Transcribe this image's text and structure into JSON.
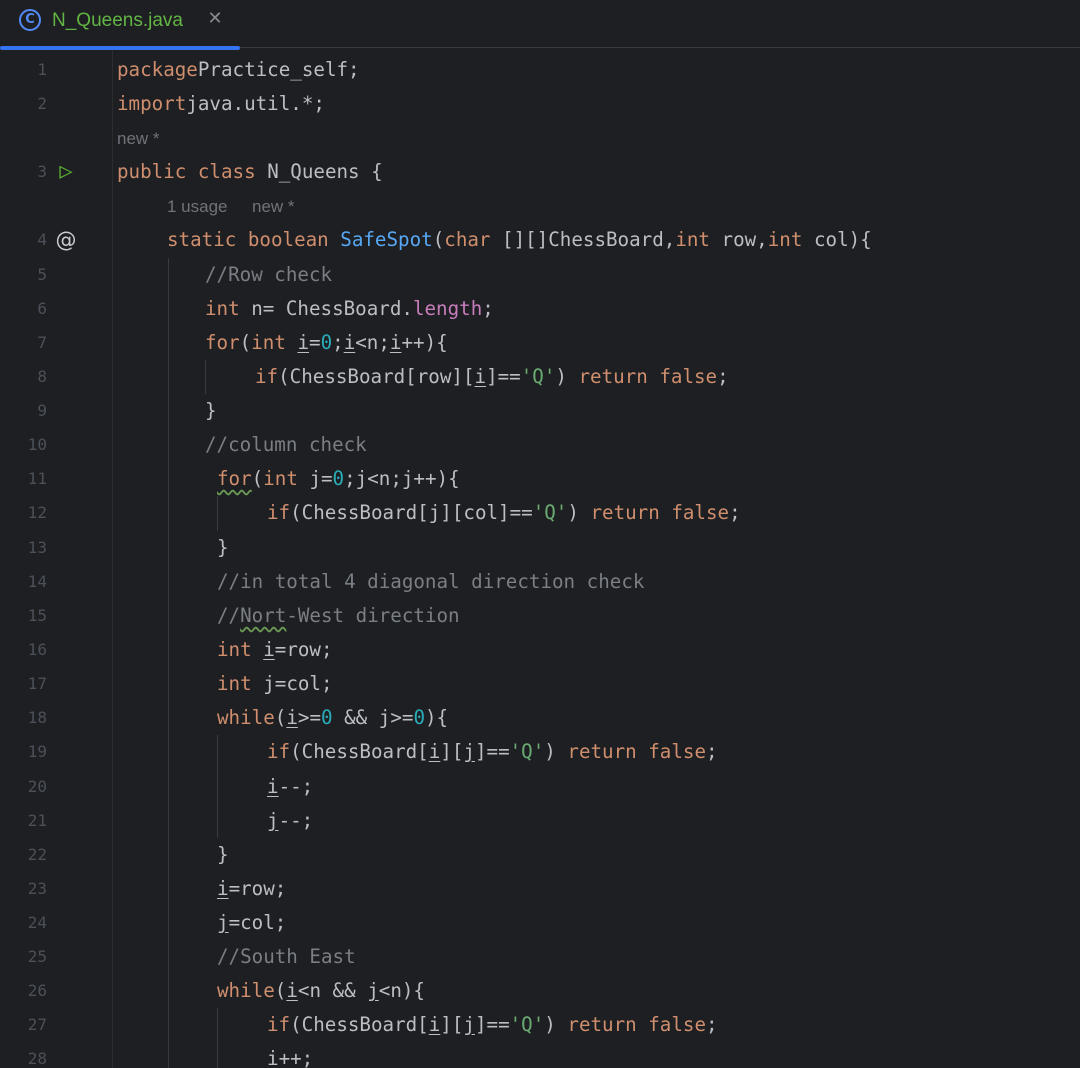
{
  "tab": {
    "icon": "class-icon",
    "icon_glyph": "C",
    "title": "N_Queens.java",
    "close_glyph": "✕"
  },
  "inlays": {
    "class_hint": "new *",
    "method_usage": "1 usage",
    "method_new": "new *"
  },
  "gutter": {
    "run_icon": "run-gutter-icon",
    "override_icon": "at-gutter-icon"
  },
  "colors": {
    "background": "#1e1f22",
    "keyword": "#cf8e6d",
    "method": "#56a8f5",
    "field": "#c77dbb",
    "number": "#2aacb8",
    "string": "#6aab73",
    "comment": "#7a7e85",
    "tab_accent": "#3574f0",
    "tab_title": "#62b543"
  },
  "lines": [
    {
      "no": "1",
      "indent": 0,
      "tokens": [
        [
          "kw",
          "package"
        ],
        [
          "",
          "Practice_self;"
        ]
      ]
    },
    {
      "no": "2",
      "indent": 0,
      "tokens": [
        [
          "kw",
          "import"
        ],
        [
          "",
          "java.util.*;"
        ]
      ]
    },
    {
      "no": "3",
      "indent": 0,
      "tokens": [
        [
          "kw",
          "public class "
        ],
        [
          "",
          "N_Queens {"
        ]
      ]
    },
    {
      "no": "4",
      "indent": 1,
      "tokens": [
        [
          "kw",
          "static boolean "
        ],
        [
          "fn",
          "SafeSpot"
        ],
        [
          "",
          "("
        ],
        [
          "kw",
          "char "
        ],
        [
          "",
          "[][]ChessBoard,"
        ],
        [
          "kw",
          "int "
        ],
        [
          "",
          "row,"
        ],
        [
          "kw",
          "int "
        ],
        [
          "",
          "col){"
        ]
      ]
    },
    {
      "no": "5",
      "indent": 2,
      "tokens": [
        [
          "cmt",
          "//Row check"
        ]
      ]
    },
    {
      "no": "6",
      "indent": 2,
      "tokens": [
        [
          "kw",
          "int "
        ],
        [
          "",
          "n= ChessBoard."
        ],
        [
          "fld",
          "length"
        ],
        [
          "",
          ";"
        ]
      ]
    },
    {
      "no": "7",
      "indent": 2,
      "tokens": [
        [
          "kw",
          "for"
        ],
        [
          "",
          "("
        ],
        [
          "kw",
          "int "
        ],
        [
          "ul",
          "i"
        ],
        [
          "",
          "="
        ],
        [
          "num",
          "0"
        ],
        [
          "",
          ";"
        ],
        [
          "ul",
          "i"
        ],
        [
          "",
          "<n;"
        ],
        [
          "ul",
          "i"
        ],
        [
          "",
          "++){"
        ]
      ]
    },
    {
      "no": "8",
      "indent": 3,
      "tokens": [
        [
          "kw",
          "if"
        ],
        [
          "",
          "(ChessBoard[row]["
        ],
        [
          "ul",
          "i"
        ],
        [
          "",
          "]=="
        ],
        [
          "str",
          "'Q'"
        ],
        [
          "",
          ") "
        ],
        [
          "kw",
          "return false"
        ],
        [
          "",
          ";"
        ]
      ]
    },
    {
      "no": "9",
      "indent": 2,
      "tokens": [
        [
          "",
          "}"
        ]
      ]
    },
    {
      "no": "10",
      "indent": 2,
      "tokens": [
        [
          "cmt",
          "//column check"
        ]
      ]
    },
    {
      "no": "11",
      "indent": 2,
      "tokens": [
        [
          "kw typo",
          "for"
        ],
        [
          "",
          "("
        ],
        [
          "kw",
          "int "
        ],
        [
          "",
          "j="
        ],
        [
          "num",
          "0"
        ],
        [
          "",
          ";j<n;j++){"
        ]
      ]
    },
    {
      "no": "12",
      "indent": 3,
      "tokens": [
        [
          "kw",
          "if"
        ],
        [
          "",
          "(ChessBoard[j][col]=="
        ],
        [
          "str",
          "'Q'"
        ],
        [
          "",
          ") "
        ],
        [
          "kw",
          "return false"
        ],
        [
          "",
          ";"
        ]
      ]
    },
    {
      "no": "13",
      "indent": 2,
      "tokens": [
        [
          "",
          "}"
        ]
      ]
    },
    {
      "no": "14",
      "indent": 2,
      "tokens": [
        [
          "cmt",
          "//in total 4 diagonal direction check"
        ]
      ]
    },
    {
      "no": "15",
      "indent": 2,
      "tokens": [
        [
          "cmt",
          "//"
        ],
        [
          "cmt typo",
          "Nort"
        ],
        [
          "cmt",
          "-West direction"
        ]
      ]
    },
    {
      "no": "16",
      "indent": 2,
      "tokens": [
        [
          "kw",
          "int "
        ],
        [
          "ul",
          "i"
        ],
        [
          "",
          "=row;"
        ]
      ]
    },
    {
      "no": "17",
      "indent": 2,
      "tokens": [
        [
          "kw",
          "int "
        ],
        [
          "",
          "j=col;"
        ]
      ]
    },
    {
      "no": "18",
      "indent": 2,
      "tokens": [
        [
          "kw",
          "while"
        ],
        [
          "",
          "("
        ],
        [
          "ul",
          "i"
        ],
        [
          "",
          ">="
        ],
        [
          "num",
          "0"
        ],
        [
          "",
          " && j>="
        ],
        [
          "num",
          "0"
        ],
        [
          "",
          "){"
        ]
      ]
    },
    {
      "no": "19",
      "indent": 3,
      "tokens": [
        [
          "kw",
          "if"
        ],
        [
          "",
          "(ChessBoard["
        ],
        [
          "ul",
          "i"
        ],
        [
          "",
          "]["
        ],
        [
          "ul",
          "j"
        ],
        [
          "",
          "]=="
        ],
        [
          "str",
          "'Q'"
        ],
        [
          "",
          ") "
        ],
        [
          "kw",
          "return false"
        ],
        [
          "",
          ";"
        ]
      ]
    },
    {
      "no": "20",
      "indent": 3,
      "tokens": [
        [
          "ul",
          "i"
        ],
        [
          "",
          "--;"
        ]
      ]
    },
    {
      "no": "21",
      "indent": 3,
      "tokens": [
        [
          "ul",
          "j"
        ],
        [
          "",
          "--;"
        ]
      ]
    },
    {
      "no": "22",
      "indent": 2,
      "tokens": [
        [
          "",
          "}"
        ]
      ]
    },
    {
      "no": "23",
      "indent": 2,
      "tokens": [
        [
          "ul",
          "i"
        ],
        [
          "",
          "=row;"
        ]
      ]
    },
    {
      "no": "24",
      "indent": 2,
      "tokens": [
        [
          "ul",
          "j"
        ],
        [
          "",
          "=col;"
        ]
      ]
    },
    {
      "no": "25",
      "indent": 2,
      "tokens": [
        [
          "cmt",
          "//South East"
        ]
      ]
    },
    {
      "no": "26",
      "indent": 2,
      "tokens": [
        [
          "kw",
          "while"
        ],
        [
          "",
          "("
        ],
        [
          "ul",
          "i"
        ],
        [
          "",
          "<n && "
        ],
        [
          "ul",
          "j"
        ],
        [
          "",
          "<n){"
        ]
      ]
    },
    {
      "no": "27",
      "indent": 3,
      "tokens": [
        [
          "kw",
          "if"
        ],
        [
          "",
          "(ChessBoard["
        ],
        [
          "ul",
          "i"
        ],
        [
          "",
          "]["
        ],
        [
          "ul",
          "j"
        ],
        [
          "",
          "]=="
        ],
        [
          "str",
          "'Q'"
        ],
        [
          "",
          ") "
        ],
        [
          "kw",
          "return false"
        ],
        [
          "",
          ";"
        ]
      ]
    },
    {
      "no": "28",
      "indent": 3,
      "tokens": [
        [
          "ul",
          "i"
        ],
        [
          "",
          "++;"
        ]
      ]
    }
  ]
}
